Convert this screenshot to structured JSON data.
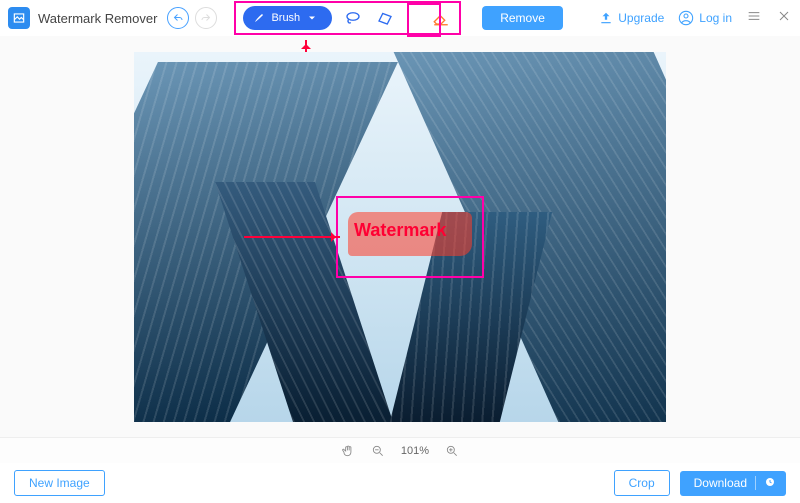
{
  "app": {
    "title": "Watermark Remover"
  },
  "toolbar": {
    "brush_label": "Brush",
    "remove_label": "Remove"
  },
  "top_right": {
    "upgrade_label": "Upgrade",
    "login_label": "Log in"
  },
  "canvas": {
    "watermark_text": "Watermark"
  },
  "zoom": {
    "value": "101%"
  },
  "footer": {
    "new_image_label": "New Image",
    "crop_label": "Crop",
    "download_label": "Download"
  },
  "colors": {
    "accent": "#3fa2ff",
    "annotation": "#ff00a8"
  }
}
